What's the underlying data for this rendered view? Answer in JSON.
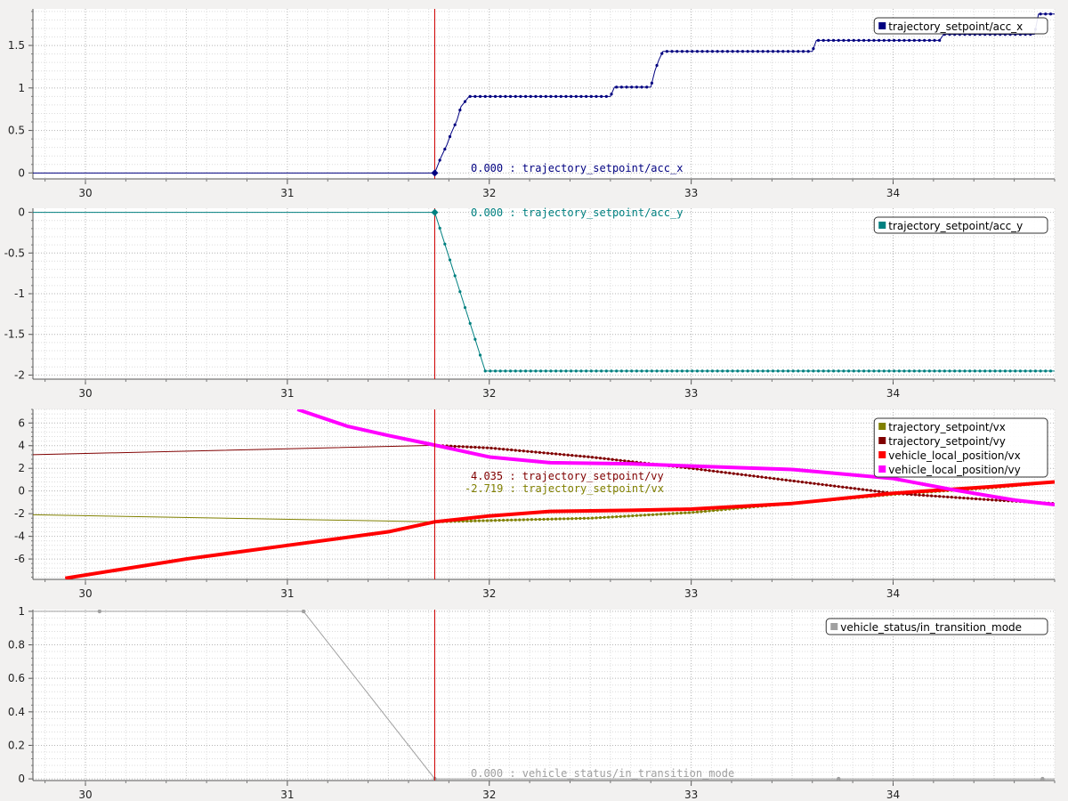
{
  "chart_data": [
    {
      "type": "line",
      "x_ticks": [
        "30",
        "31",
        "32",
        "33",
        "34"
      ],
      "y_ticks": [
        "0",
        "0.5",
        "1",
        "1.5"
      ],
      "xlim": [
        29.74,
        34.8
      ],
      "ylim": [
        -0.07,
        1.93
      ],
      "grid": true,
      "legend_position": "top-right",
      "series": [
        {
          "name": "trajectory_setpoint/acc_x",
          "color": "#000080",
          "marker": "dots",
          "x": [
            29.74,
            31.73,
            31.76,
            31.79,
            31.81,
            31.84,
            31.86,
            31.9,
            32.6,
            32.62,
            32.8,
            32.82,
            32.84,
            32.86,
            33.6,
            33.62,
            34.23,
            34.25,
            34.7,
            34.72,
            34.8
          ],
          "y": [
            0,
            0,
            0.18,
            0.33,
            0.46,
            0.62,
            0.78,
            0.9,
            0.9,
            1.01,
            1.01,
            1.2,
            1.33,
            1.43,
            1.43,
            1.56,
            1.56,
            1.63,
            1.63,
            1.87,
            1.87
          ]
        }
      ],
      "readouts": [
        {
          "text": "0.000 : trajectory_setpoint/acc_x",
          "color": "#000080"
        }
      ]
    },
    {
      "type": "line",
      "x_ticks": [
        "30",
        "31",
        "32",
        "33",
        "34"
      ],
      "y_ticks": [
        "0",
        "-0.5",
        "-1",
        "-1.5",
        "-2"
      ],
      "xlim": [
        29.74,
        34.8
      ],
      "ylim": [
        -2.05,
        0.05
      ],
      "grid": true,
      "legend_position": "top-right",
      "series": [
        {
          "name": "trajectory_setpoint/acc_y",
          "color": "#008080",
          "marker": "dots",
          "x": [
            29.74,
            31.73,
            31.98,
            34.8
          ],
          "y": [
            0,
            0,
            -1.95,
            -1.95
          ]
        }
      ],
      "readouts": [
        {
          "text": "0.000 : trajectory_setpoint/acc_y",
          "color": "#008080"
        }
      ]
    },
    {
      "type": "line",
      "x_ticks": [
        "30",
        "31",
        "32",
        "33",
        "34"
      ],
      "y_ticks": [
        "6",
        "4",
        "2",
        "0",
        "-2",
        "-4",
        "-6"
      ],
      "xlim": [
        29.74,
        34.8
      ],
      "ylim": [
        -7.8,
        7.2
      ],
      "grid": true,
      "legend_position": "top-right",
      "series": [
        {
          "name": "trajectory_setpoint/vx",
          "color": "#808000",
          "x": [
            29.74,
            31.73,
            32.5,
            33.0,
            33.5,
            34.0,
            34.5,
            34.8
          ],
          "y": [
            -2.1,
            -2.72,
            -2.4,
            -1.9,
            -1.1,
            -0.3,
            0.3,
            0.8
          ]
        },
        {
          "name": "trajectory_setpoint/vy",
          "color": "#800000",
          "x": [
            29.74,
            31.73,
            32.0,
            32.5,
            33.0,
            33.5,
            34.0,
            34.5,
            34.8
          ],
          "y": [
            3.2,
            4.03,
            3.8,
            3.0,
            2.0,
            0.9,
            -0.2,
            -0.8,
            -1.1
          ]
        },
        {
          "name": "vehicle_local_position/vx",
          "color": "#ff0000",
          "x": [
            29.9,
            30.5,
            31.0,
            31.5,
            31.73,
            32.0,
            32.3,
            32.7,
            33.0,
            33.5,
            34.0,
            34.5,
            34.8
          ],
          "y": [
            -7.7,
            -6.0,
            -4.8,
            -3.6,
            -2.72,
            -2.2,
            -1.8,
            -1.7,
            -1.6,
            -1.1,
            -0.2,
            0.4,
            0.8
          ]
        },
        {
          "name": "vehicle_local_position/vy",
          "color": "#ff00ff",
          "x": [
            31.05,
            31.3,
            31.5,
            31.73,
            32.0,
            32.3,
            32.7,
            33.0,
            33.5,
            34.0,
            34.3,
            34.6,
            34.8
          ],
          "y": [
            7.2,
            5.7,
            4.9,
            4.05,
            3.0,
            2.5,
            2.4,
            2.2,
            1.9,
            1.1,
            0.1,
            -0.8,
            -1.2
          ]
        }
      ],
      "readouts": [
        {
          "text": "4.035 : trajectory_setpoint/vy",
          "color": "#800000"
        },
        {
          "text": "-2.719 : trajectory_setpoint/vx",
          "color": "#808000"
        }
      ]
    },
    {
      "type": "line",
      "x_ticks": [
        "30",
        "31",
        "32",
        "33",
        "34"
      ],
      "y_ticks": [
        "1",
        "0.8",
        "0.6",
        "0.4",
        "0.2",
        "0"
      ],
      "xlim": [
        29.74,
        34.8
      ],
      "ylim": [
        -0.01,
        1.01
      ],
      "grid": true,
      "legend_position": "top-right",
      "series": [
        {
          "name": "vehicle_status/in_transition_mode",
          "color": "#a0a0a0",
          "x": [
            29.74,
            30.07,
            31.08,
            31.73,
            33.73,
            34.74,
            34.8
          ],
          "y": [
            1,
            1,
            1,
            0,
            0,
            0,
            0
          ],
          "points": [
            [
              30.07,
              1
            ],
            [
              31.08,
              1
            ],
            [
              31.73,
              0
            ],
            [
              33.73,
              0
            ],
            [
              34.74,
              0
            ]
          ]
        }
      ],
      "readouts": [
        {
          "text": "0.000 : vehicle_status/in_transition_mode",
          "color": "#a0a0a0"
        }
      ]
    }
  ],
  "cursor": {
    "x": 31.73,
    "color": "#d00000"
  }
}
